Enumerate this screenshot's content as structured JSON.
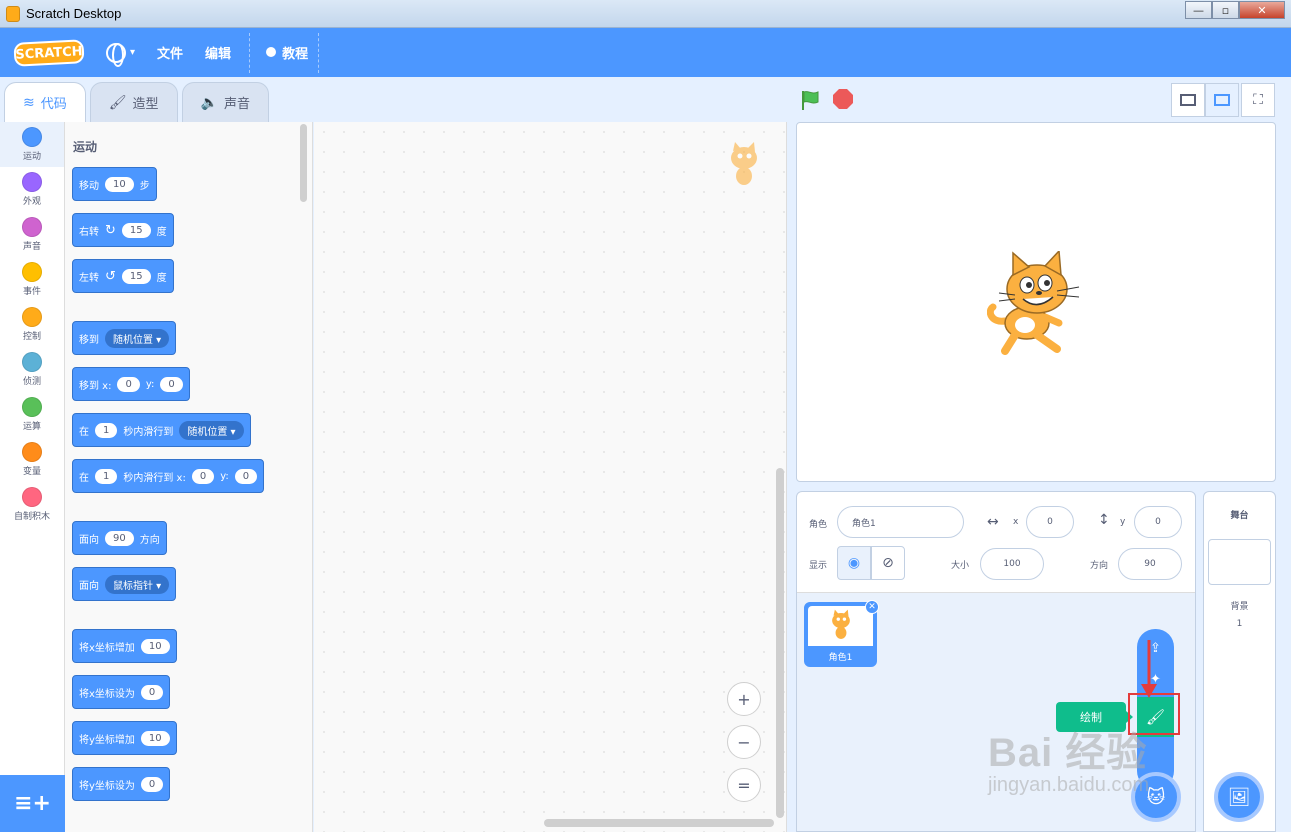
{
  "window": {
    "title": "Scratch Desktop",
    "buttons": [
      "—",
      "▫",
      "✕"
    ]
  },
  "menubar": {
    "logo": "SCRATCH",
    "language_icon": "globe-icon",
    "file": "文件",
    "edit": "编辑",
    "tutorials": "教程"
  },
  "tabs": [
    {
      "label": "代码",
      "icon": "code-icon",
      "active": true
    },
    {
      "label": "造型",
      "icon": "brush-icon",
      "active": false
    },
    {
      "label": "声音",
      "icon": "speaker-icon",
      "active": false
    }
  ],
  "categories": [
    {
      "label": "运动",
      "color": "#4c97ff"
    },
    {
      "label": "外观",
      "color": "#9966ff"
    },
    {
      "label": "声音",
      "color": "#cf63cf"
    },
    {
      "label": "事件",
      "color": "#ffbf00"
    },
    {
      "label": "控制",
      "color": "#ffab19"
    },
    {
      "label": "侦测",
      "color": "#5cb1d6"
    },
    {
      "label": "运算",
      "color": "#59c059"
    },
    {
      "label": "变量",
      "color": "#ff8c1a"
    },
    {
      "label": "自制积木",
      "color": "#ff6680"
    }
  ],
  "palette": {
    "section_title": "运动",
    "blocks": {
      "move": {
        "label": "移动",
        "value": "10",
        "suffix": "步"
      },
      "turn_right": {
        "label": "右转",
        "icon": "↻",
        "value": "15",
        "suffix": "度"
      },
      "turn_left": {
        "label": "左转",
        "icon": "↺",
        "value": "15",
        "suffix": "度"
      },
      "goto": {
        "label": "移到",
        "dropdown": "随机位置"
      },
      "goto_xy": {
        "label": "移到 x:",
        "x": "0",
        "ylabel": "y:",
        "y": "0"
      },
      "glide": {
        "label": "在",
        "secs": "1",
        "mid": "秒内滑行到",
        "dropdown": "随机位置"
      },
      "glide_xy": {
        "label": "在",
        "secs": "1",
        "mid": "秒内滑行到 x:",
        "x": "0",
        "ylabel": "y:",
        "y": "0"
      },
      "point_dir": {
        "label": "面向",
        "value": "90",
        "suffix": "方向"
      },
      "point_towards": {
        "label": "面向",
        "dropdown": "鼠标指针"
      },
      "change_x": {
        "label": "将x坐标增加",
        "value": "10"
      },
      "set_x": {
        "label": "将x坐标设为",
        "value": "0"
      },
      "change_y": {
        "label": "将y坐标增加",
        "value": "10"
      },
      "set_y": {
        "label": "将y坐标设为",
        "value": "0"
      }
    }
  },
  "zoom": {
    "in": "+",
    "out": "−",
    "reset": "="
  },
  "sprite_info": {
    "sprite_label": "角色",
    "sprite_name": "角色1",
    "x_label": "x",
    "x_value": "0",
    "y_label": "y",
    "y_value": "0",
    "show_label": "显示",
    "size_label": "大小",
    "size_value": "100",
    "direction_label": "方向",
    "direction_value": "90"
  },
  "sprite_list": [
    {
      "name": "角色1",
      "selected": true
    }
  ],
  "add_sprite_menu": {
    "paint_tooltip": "绘制"
  },
  "stage_pane": {
    "title": "舞台",
    "backdrops_label": "背景",
    "backdrops_count": "1"
  },
  "watermark": {
    "main": "Bai 经验",
    "url": "jingyan.baidu.com"
  }
}
